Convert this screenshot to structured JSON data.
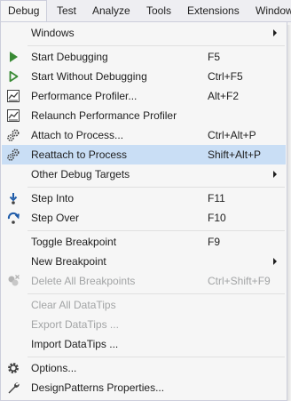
{
  "menubar": {
    "items": [
      "Debug",
      "Test",
      "Analyze",
      "Tools",
      "Extensions",
      "Window"
    ]
  },
  "menu": {
    "windows": "Windows",
    "start_debugging": {
      "label": "Start Debugging",
      "key": "F5"
    },
    "start_without_debugging": {
      "label": "Start Without Debugging",
      "key": "Ctrl+F5"
    },
    "performance_profiler": {
      "label": "Performance Profiler...",
      "key": "Alt+F2"
    },
    "relaunch_profiler": {
      "label": "Relaunch Performance Profiler"
    },
    "attach_to_process": {
      "label": "Attach to Process...",
      "key": "Ctrl+Alt+P"
    },
    "reattach_to_process": {
      "label": "Reattach to Process",
      "key": "Shift+Alt+P"
    },
    "other_debug_targets": "Other Debug Targets",
    "step_into": {
      "label": "Step Into",
      "key": "F11"
    },
    "step_over": {
      "label": "Step Over",
      "key": "F10"
    },
    "toggle_breakpoint": {
      "label": "Toggle Breakpoint",
      "key": "F9"
    },
    "new_breakpoint": "New Breakpoint",
    "delete_all_breakpoints": {
      "label": "Delete All Breakpoints",
      "key": "Ctrl+Shift+F9"
    },
    "clear_all_datatips": "Clear All DataTips",
    "export_datatips": "Export DataTips ...",
    "import_datatips": "Import DataTips ...",
    "options": "Options...",
    "designpatterns_properties": "DesignPatterns Properties..."
  },
  "colors": {
    "highlight": "#c9def5",
    "menu_bg": "#f6f6f6",
    "disabled_text": "#a2a4a5",
    "play_green": "#388a34",
    "step_blue": "#1e5ba8"
  }
}
